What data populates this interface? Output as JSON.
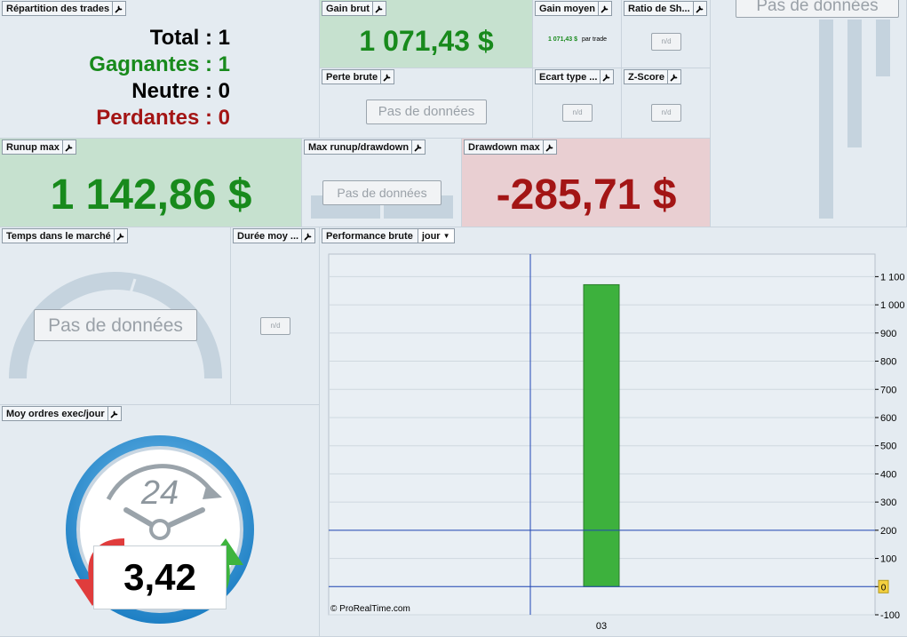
{
  "repartition": {
    "title": "Répartition des trades",
    "lines": [
      {
        "label": "Total : 1",
        "color": "#000000"
      },
      {
        "label": "Gagnantes : 1",
        "color": "#188a1c"
      },
      {
        "label": "Neutre : 0",
        "color": "#000000"
      },
      {
        "label": "Perdantes : 0",
        "color": "#a31515"
      }
    ]
  },
  "gain_brut": {
    "title": "Gain brut",
    "value": "1 071,43 $"
  },
  "gain_moyen": {
    "title": "Gain moyen",
    "value": "1 071,43 $",
    "suffix": "par trade"
  },
  "ratio_sharpe": {
    "title": "Ratio de Sh...",
    "value": "n/d"
  },
  "pas_donnees_top": {
    "value": "Pas de données"
  },
  "perte_brute": {
    "title": "Perte brute",
    "value": "Pas de données"
  },
  "ecart_type": {
    "title": "Ecart type ...",
    "value": "n/d"
  },
  "z_score": {
    "title": "Z-Score",
    "value": "n/d"
  },
  "runup_max": {
    "title": "Runup max",
    "value": "1 142,86 $"
  },
  "max_runup_drawdown": {
    "title": "Max runup/drawdown",
    "value": "Pas de données"
  },
  "drawdown_max": {
    "title": "Drawdown max",
    "value": "-285,71 $"
  },
  "temps_marche": {
    "title": "Temps dans le marché",
    "value": "Pas de données"
  },
  "duree_moy": {
    "title": "Durée moy ...",
    "value": "n/d"
  },
  "moy_ordres": {
    "title": "Moy ordres exec/jour",
    "clock_label": "24",
    "value": "3,42"
  },
  "performance": {
    "title": "Performance brute",
    "period": "jour",
    "watermark": "© ProRealTime.com"
  },
  "colors": {
    "green_text": "#188a1c",
    "red_text": "#a31515",
    "bar": "#3db13d",
    "line": "#2046b4"
  },
  "chart_data": {
    "type": "bar",
    "categories": [
      "03"
    ],
    "values": [
      1071.43
    ],
    "yticks": [
      -100,
      0,
      100,
      200,
      300,
      400,
      500,
      600,
      700,
      800,
      900,
      1000,
      1100
    ],
    "ytick_labels": [
      "-100",
      "0",
      "100",
      "200",
      "300",
      "400",
      "500",
      "600",
      "700",
      "800",
      "900",
      "1 000",
      "1 100"
    ],
    "ylim": [
      -100,
      1180
    ],
    "hlines": [
      0,
      200
    ],
    "zero_marker": "0"
  }
}
